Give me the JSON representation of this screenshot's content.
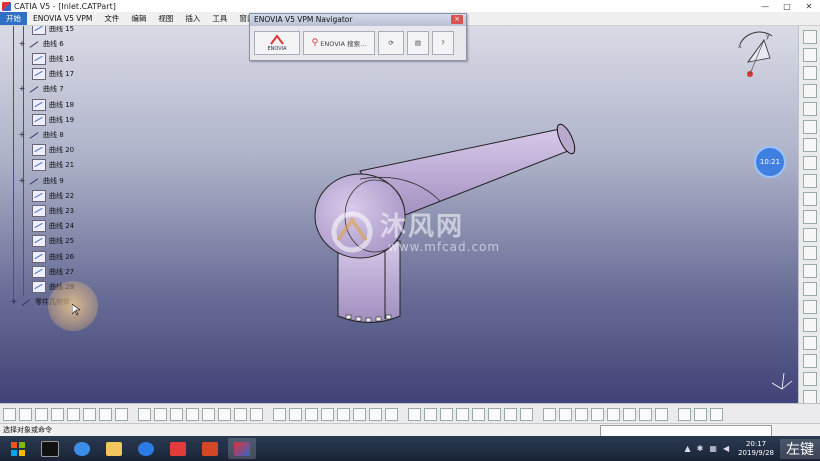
{
  "window": {
    "title": "CATIA V5 - [Inlet.CATPart]",
    "controls": [
      "—",
      "□",
      "✕"
    ]
  },
  "menu": {
    "items": [
      "开始",
      "ENOVIA V5 VPM",
      "文件",
      "编辑",
      "视图",
      "插入",
      "工具",
      "窗口",
      "帮助"
    ]
  },
  "tree": {
    "nodes": [
      {
        "kind": "leaf",
        "label": "曲线 15"
      },
      {
        "kind": "sketch",
        "label": "曲线 6"
      },
      {
        "kind": "leaf",
        "label": "曲线 16"
      },
      {
        "kind": "leaf",
        "label": "曲线 17"
      },
      {
        "kind": "sketch",
        "label": "曲线 7"
      },
      {
        "kind": "leaf",
        "label": "曲线 18"
      },
      {
        "kind": "leaf",
        "label": "曲线 19"
      },
      {
        "kind": "sketch",
        "label": "曲线 8"
      },
      {
        "kind": "leaf",
        "label": "曲线 20"
      },
      {
        "kind": "leaf",
        "label": "曲线 21"
      },
      {
        "kind": "sketch",
        "label": "曲线 9"
      },
      {
        "kind": "leaf",
        "label": "曲线 22"
      },
      {
        "kind": "leaf",
        "label": "曲线 23"
      },
      {
        "kind": "leaf",
        "label": "曲线 24"
      },
      {
        "kind": "leaf",
        "label": "曲线 25"
      },
      {
        "kind": "leaf",
        "label": "曲线 26"
      },
      {
        "kind": "leaf",
        "label": "曲线 27"
      },
      {
        "kind": "leaf",
        "label": "曲线 28"
      },
      {
        "kind": "root",
        "label": "零件几何体"
      }
    ]
  },
  "navigator": {
    "title": "ENOVIA V5 VPM Navigator",
    "logo_text": "ENOVIA",
    "search_label": "ENOVIA 搜索..."
  },
  "clock_badge": "10:21",
  "watermark": {
    "main": "沐风网",
    "url": "www.mfcad.com"
  },
  "statusbar": {
    "text": "选择对象或命令"
  },
  "taskbar": {
    "time": "20:17",
    "date": "2019/9/28",
    "ime": "左键"
  },
  "colors": {
    "part": "#b9a9cf",
    "viewport_top": "#d9dbe6",
    "viewport_bottom": "#3f4377",
    "accent": "#2f6fc4"
  }
}
